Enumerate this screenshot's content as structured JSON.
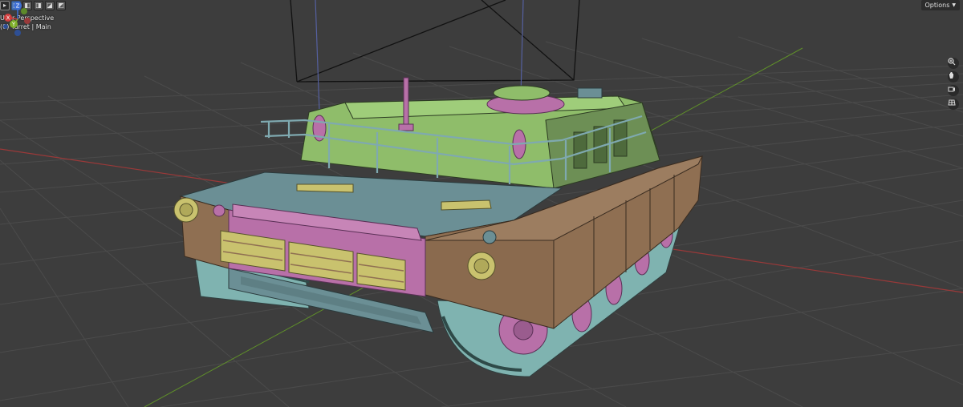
{
  "header": {
    "options_label": "Options"
  },
  "viewport": {
    "view_name": "User Perspective",
    "object_info": "(0) Turret | Main"
  },
  "gizmo": {
    "z_label": "Z",
    "x_label": "X",
    "y_label": "Y"
  },
  "colors": {
    "background": "#3d3d3d",
    "grid": "#4a4a4a",
    "x_axis": "#a03a3a",
    "y_axis": "#6a9a2a",
    "hull_blue": "#6b8f95",
    "armor_brown": "#8f6f52",
    "turret_green": "#8fbd6a",
    "magenta": "#b870a8",
    "yellow": "#c9c26e",
    "track_teal": "#7fb3b0"
  },
  "icons": {
    "tool_select": "cursor-icon",
    "mode_new": "select-box-new-icon",
    "mode_extend": "select-box-extend-icon",
    "mode_subtract": "select-box-subtract-icon",
    "mode_difference": "select-box-difference-icon",
    "mode_intersect": "select-box-intersect-icon",
    "zoom": "zoom-icon",
    "pan": "hand-pan-icon",
    "camera": "camera-icon",
    "grid": "ortho-grid-icon"
  }
}
